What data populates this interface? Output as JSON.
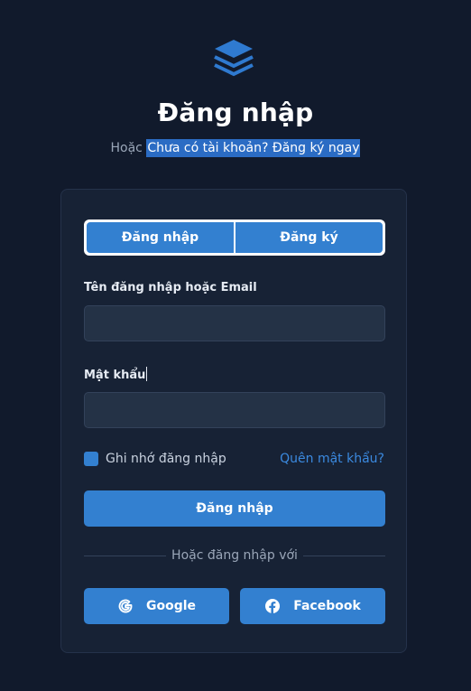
{
  "header": {
    "logo_icon": "layers-icon",
    "title": "Đăng nhập",
    "subtitle_prefix": "Hoặc",
    "register_link": "Chưa có tài khoản? Đăng ký ngay"
  },
  "tabs": [
    {
      "label": "Đăng nhập"
    },
    {
      "label": "Đăng ký"
    }
  ],
  "form": {
    "username_label": "Tên đăng nhập hoặc Email",
    "username_value": "",
    "password_label": "Mật khẩu",
    "password_value": "",
    "remember_label": "Ghi nhớ đăng nhập",
    "remember_checked": true,
    "forgot_link": "Quên mật khẩu?",
    "submit_label": "Đăng nhập"
  },
  "divider_text": "Hoặc đăng nhập với",
  "social": {
    "google_label": "Google",
    "google_icon": "google-icon",
    "facebook_label": "Facebook",
    "facebook_icon": "facebook-icon"
  },
  "colors": {
    "background": "#111a2c",
    "card": "#172235",
    "accent": "#3380d0",
    "link": "#3b8ae0"
  }
}
